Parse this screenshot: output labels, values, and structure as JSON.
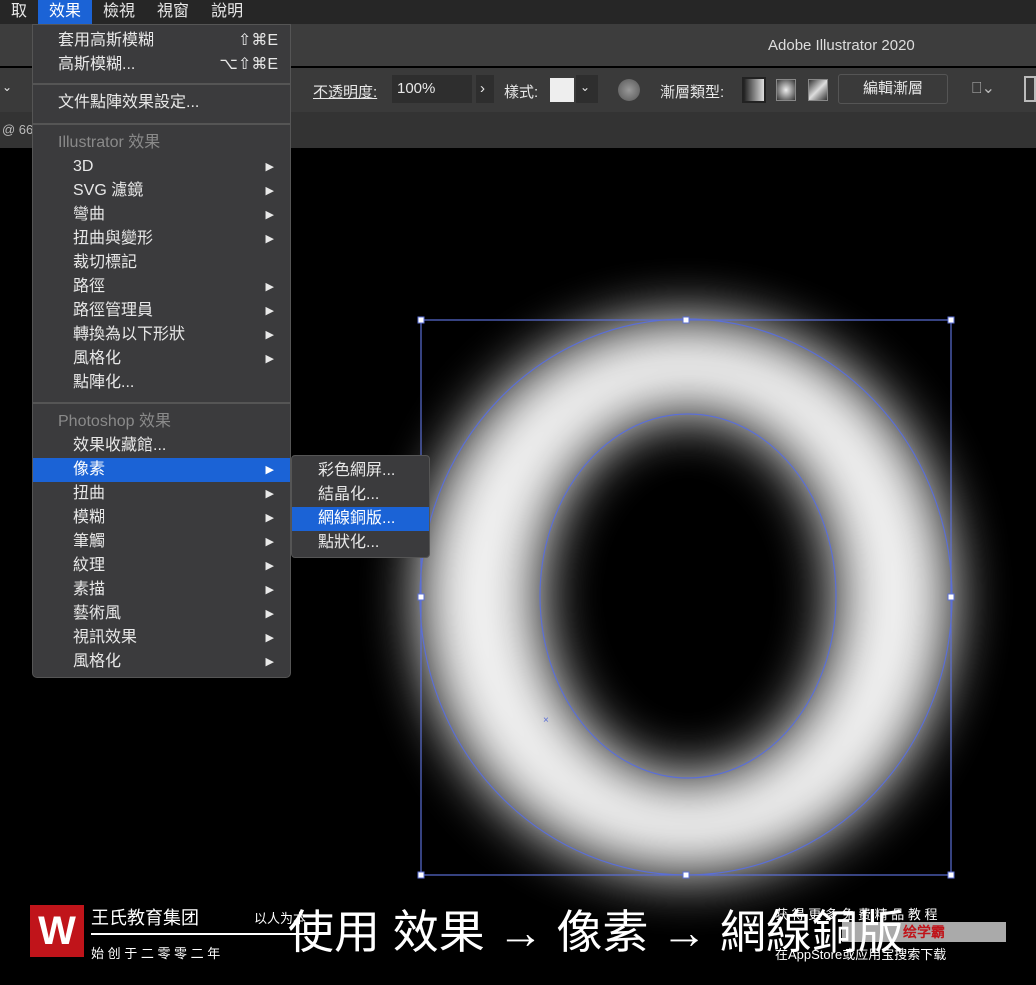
{
  "menubar": {
    "items": [
      "取",
      "效果",
      "檢視",
      "視窗",
      "說明"
    ],
    "active": 1
  },
  "titlebar": {
    "title": "Adobe Illustrator 2020"
  },
  "control": {
    "opacity_label": "不透明度:",
    "opacity_value": "100%",
    "style_label": "樣式:",
    "gradient_type_label": "漸層類型:",
    "edit_gradient": "編輯漸層"
  },
  "tab": {
    "zoom": "@ 66"
  },
  "effect_menu": {
    "apply": "套用高斯模糊",
    "apply_sc": "⇧⌘E",
    "gauss": "高斯模糊...",
    "gauss_sc": "⌥⇧⌘E",
    "doc_raster": "文件點陣效果設定...",
    "ill_header": "Illustrator 效果",
    "ill_items": [
      "3D",
      "SVG 濾鏡",
      "彎曲",
      "扭曲與變形",
      "裁切標記",
      "路徑",
      "路徑管理員",
      "轉換為以下形狀",
      "風格化",
      "點陣化..."
    ],
    "ps_header": "Photoshop 效果",
    "ps_items": [
      "效果收藏館...",
      "像素",
      "扭曲",
      "模糊",
      "筆觸",
      "紋理",
      "素描",
      "藝術風",
      "視訊效果",
      "風格化"
    ]
  },
  "pixel_submenu": {
    "items": [
      "彩色網屏...",
      "結晶化...",
      "網線銅版...",
      "點狀化..."
    ],
    "highlighted": 2
  },
  "caption": "使用 效果 → 像素 → 網線銅版",
  "watermark": {
    "brand": "王氏教育集团",
    "slogan": "以人为本",
    "founded": "始 创 于 二 零 零 二 年",
    "promo": "获 得 更 多 免 费 精 品 教 程",
    "app": "绘学霸",
    "store": "在AppStore或应用宝搜索下载"
  },
  "colors": {
    "accent": "#1b63d6",
    "selection": "#5b6fd6"
  }
}
